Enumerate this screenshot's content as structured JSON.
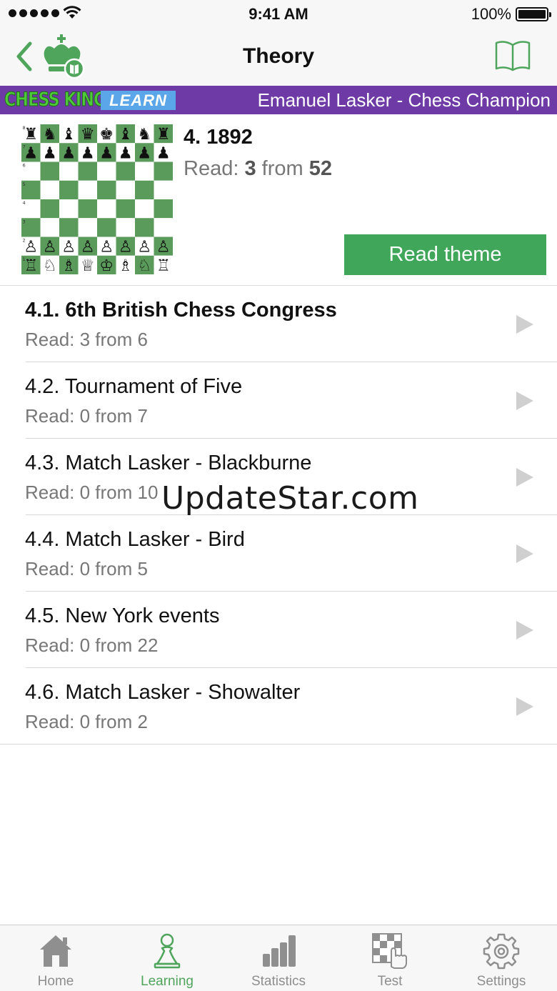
{
  "status_bar": {
    "time": "9:41 AM",
    "battery": "100%"
  },
  "nav": {
    "title": "Theory",
    "icons": {
      "back": "chevron-left-icon",
      "logo": "chess-king-crown-logo",
      "book": "book-icon"
    }
  },
  "banner": {
    "brand": "CHESS KING",
    "badge": "LEARN",
    "title": "Emanuel Lasker - Chess Champion"
  },
  "theme": {
    "title": "4. 1892",
    "progress_prefix": "Read: ",
    "read": "3",
    "progress_mid": " from ",
    "total": "52",
    "button_label": "Read theme"
  },
  "chapters": [
    {
      "title": "4.1. 6th British Chess Congress",
      "progress": "Read: 3 from 6",
      "bold": true
    },
    {
      "title": "4.2. Tournament of Five",
      "progress": "Read: 0 from 7",
      "bold": false
    },
    {
      "title": "4.3. Match Lasker - Blackburne",
      "progress": "Read: 0 from 10",
      "bold": false
    },
    {
      "title": "4.4. Match Lasker - Bird",
      "progress": "Read: 0 from 5",
      "bold": false
    },
    {
      "title": "4.5. New York events",
      "progress": "Read: 0 from 22",
      "bold": false
    },
    {
      "title": "4.6. Match Lasker - Showalter",
      "progress": "Read: 0 from 2",
      "bold": false
    }
  ],
  "watermark": "UpdateStar.com",
  "tabs": [
    {
      "label": "Home",
      "icon": "home-icon",
      "active": false
    },
    {
      "label": "Learning",
      "icon": "pawn-icon",
      "active": true
    },
    {
      "label": "Statistics",
      "icon": "bar-chart-icon",
      "active": false
    },
    {
      "label": "Test",
      "icon": "chessboard-tap-icon",
      "active": false
    },
    {
      "label": "Settings",
      "icon": "gear-icon",
      "active": false
    }
  ],
  "colors": {
    "accent_green": "#3fa65a",
    "banner_purple": "#6d3aa6",
    "board_dark": "#5a9a5a",
    "board_light": "#ffffff"
  }
}
